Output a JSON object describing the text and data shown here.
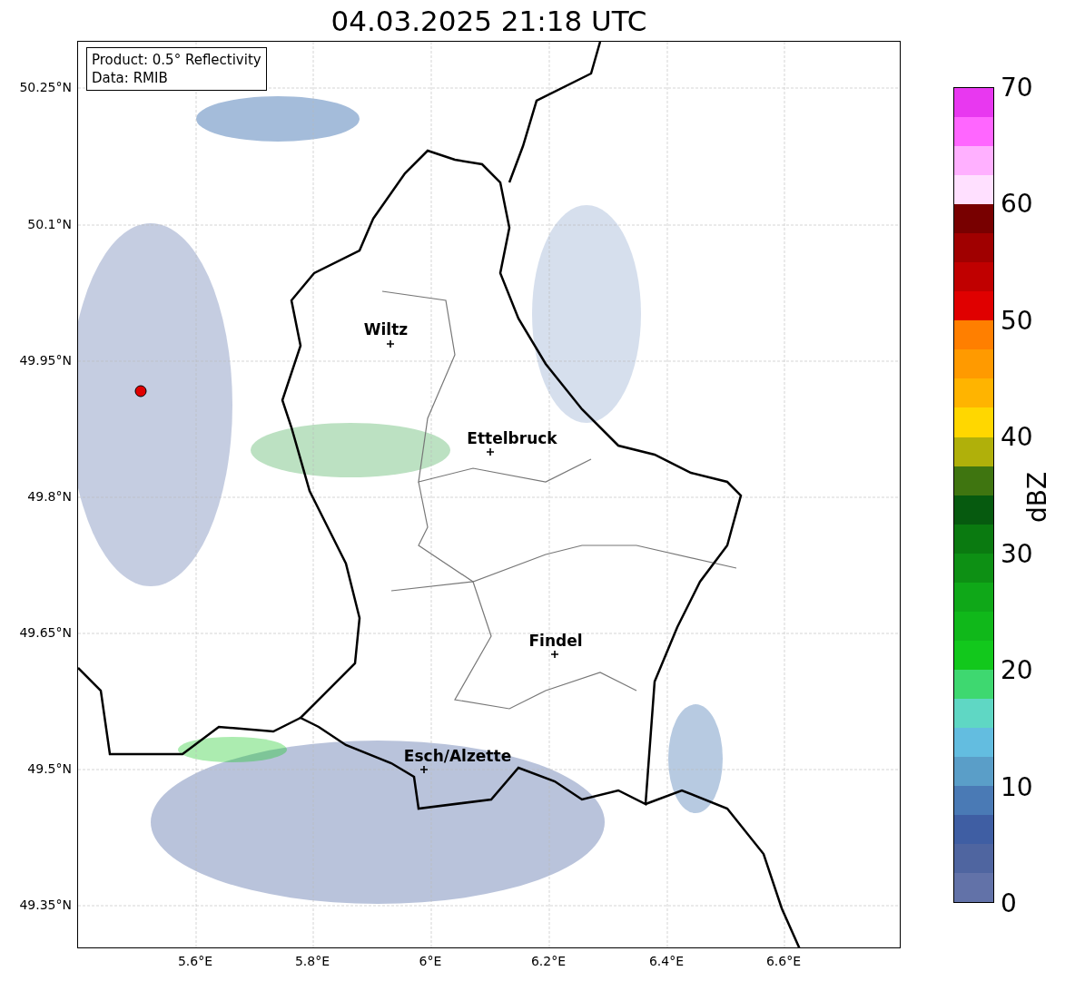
{
  "title": "04.03.2025 21:18 UTC",
  "info_box": [
    "Product: 0.5° Reflectivity",
    "Data: RMIB"
  ],
  "y_ticks": [
    "50.25°N",
    "50.1°N",
    "49.95°N",
    "49.8°N",
    "49.65°N",
    "49.5°N",
    "49.35°N"
  ],
  "x_ticks": [
    "5.6°E",
    "5.8°E",
    "6°E",
    "6.2°E",
    "6.4°E",
    "6.6°E"
  ],
  "cities": [
    {
      "name": "Wiltz"
    },
    {
      "name": "Ettelbruck"
    },
    {
      "name": "Findel"
    },
    {
      "name": "Esch/Alzette"
    }
  ],
  "colorbar": {
    "label": "dBZ",
    "ticks": [
      "70",
      "60",
      "50",
      "40",
      "30",
      "20",
      "10",
      "0"
    ],
    "bins": [
      {
        "color": "#6272a8"
      },
      {
        "color": "#4f65a0"
      },
      {
        "color": "#3f5ea3"
      },
      {
        "color": "#4a7ab5"
      },
      {
        "color": "#5a9ec8"
      },
      {
        "color": "#63bde0"
      },
      {
        "color": "#5fd7c4"
      },
      {
        "color": "#3ed870"
      },
      {
        "color": "#12c81c"
      },
      {
        "color": "#10b81a"
      },
      {
        "color": "#0fa818"
      },
      {
        "color": "#0d9014"
      },
      {
        "color": "#0a7a10"
      },
      {
        "color": "#065a0f"
      },
      {
        "color": "#3f7510"
      },
      {
        "color": "#b0b00a"
      },
      {
        "color": "#ffd700"
      },
      {
        "color": "#ffb400"
      },
      {
        "color": "#ff9a00"
      },
      {
        "color": "#ff7f00"
      },
      {
        "color": "#e00000"
      },
      {
        "color": "#c00000"
      },
      {
        "color": "#a00000"
      },
      {
        "color": "#780000"
      },
      {
        "color": "#ffe0ff"
      },
      {
        "color": "#ffb0ff"
      },
      {
        "color": "#ff66ff"
      },
      {
        "color": "#e838f0"
      }
    ]
  }
}
